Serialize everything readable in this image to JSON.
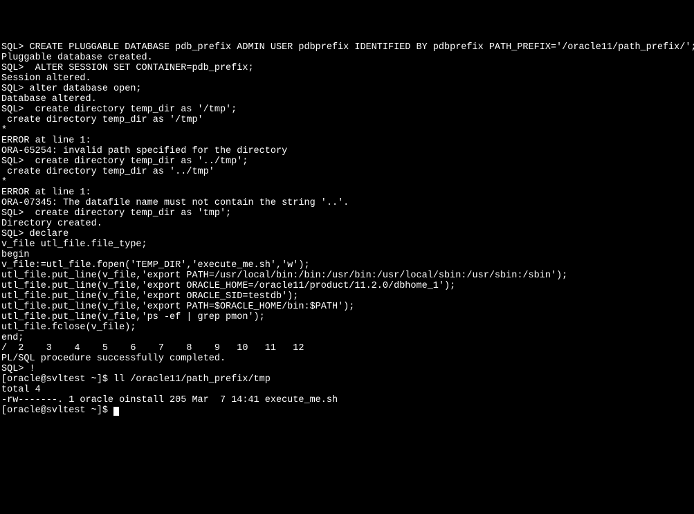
{
  "terminal": {
    "lines": [
      "SQL> CREATE PLUGGABLE DATABASE pdb_prefix ADMIN USER pdbprefix IDENTIFIED BY pdbprefix PATH_PREFIX='/oracle11/path_prefix/';",
      "",
      "Pluggable database created.",
      "",
      "SQL>  ALTER SESSION SET CONTAINER=pdb_prefix;",
      "",
      "Session altered.",
      "",
      "SQL> alter database open;",
      "",
      "Database altered.",
      "",
      "SQL>  create directory temp_dir as '/tmp';",
      " create directory temp_dir as '/tmp'",
      "*",
      "ERROR at line 1:",
      "ORA-65254: invalid path specified for the directory",
      "",
      "",
      "SQL>  create directory temp_dir as '../tmp';",
      " create directory temp_dir as '../tmp'",
      "*",
      "ERROR at line 1:",
      "ORA-07345: The datafile name must not contain the string '..'.",
      "",
      "",
      "SQL>  create directory temp_dir as 'tmp';",
      "",
      "Directory created.",
      "",
      "SQL> declare",
      "v_file utl_file.file_type;",
      "begin",
      "v_file:=utl_file.fopen('TEMP_DIR','execute_me.sh','w');",
      "utl_file.put_line(v_file,'export PATH=/usr/local/bin:/bin:/usr/bin:/usr/local/sbin:/usr/sbin:/sbin');",
      "utl_file.put_line(v_file,'export ORACLE_HOME=/oracle11/product/11.2.0/dbhome_1');",
      "utl_file.put_line(v_file,'export ORACLE_SID=testdb');",
      "utl_file.put_line(v_file,'export PATH=$ORACLE_HOME/bin:$PATH');",
      "utl_file.put_line(v_file,'ps -ef | grep pmon');",
      "utl_file.fclose(v_file);",
      "end;",
      "/  2    3    4    5    6    7    8    9   10   11   12",
      "",
      "PL/SQL procedure successfully completed.",
      "",
      "SQL> !",
      "[oracle@svltest ~]$ ll /oracle11/path_prefix/tmp",
      "total 4",
      "-rw-------. 1 oracle oinstall 205 Mar  7 14:41 execute_me.sh"
    ],
    "prompt_line": "[oracle@svltest ~]$ "
  }
}
